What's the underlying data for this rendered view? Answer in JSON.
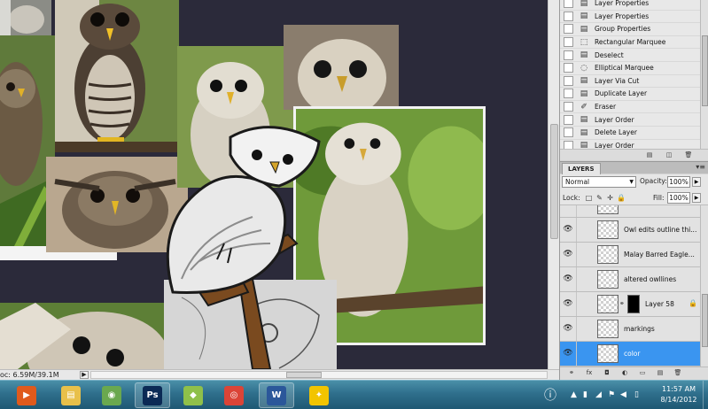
{
  "history": {
    "items": [
      {
        "label": "Layer Properties",
        "icon": "doc-icon"
      },
      {
        "label": "Layer Properties",
        "icon": "doc-icon"
      },
      {
        "label": "Group Properties",
        "icon": "doc-icon"
      },
      {
        "label": "Rectangular Marquee",
        "icon": "rect-marquee-icon"
      },
      {
        "label": "Deselect",
        "icon": "doc-icon"
      },
      {
        "label": "Elliptical Marquee",
        "icon": "ellipse-marquee-icon"
      },
      {
        "label": "Layer Via Cut",
        "icon": "doc-icon"
      },
      {
        "label": "Duplicate Layer",
        "icon": "doc-icon"
      },
      {
        "label": "Eraser",
        "icon": "eraser-icon"
      },
      {
        "label": "Layer Order",
        "icon": "doc-icon"
      },
      {
        "label": "Delete Layer",
        "icon": "doc-icon"
      },
      {
        "label": "Layer Order",
        "icon": "doc-icon"
      }
    ]
  },
  "layers_panel": {
    "tab_label": "LAYERS",
    "blend_mode": "Normal",
    "opacity_label": "Opacity:",
    "opacity_value": "100%",
    "lock_label": "Lock:",
    "fill_label": "Fill:",
    "fill_value": "100%",
    "layers": [
      {
        "name": "",
        "visible": false,
        "selected": false
      },
      {
        "name": "Owl edits outline thi...",
        "visible": true,
        "selected": false
      },
      {
        "name": "Malay Barred Eagle...",
        "visible": true,
        "selected": false
      },
      {
        "name": "altered owllines",
        "visible": true,
        "selected": false
      },
      {
        "name": "Layer 58",
        "visible": true,
        "selected": false,
        "has_mask": true
      },
      {
        "name": "markings",
        "visible": true,
        "selected": false
      },
      {
        "name": "color",
        "visible": true,
        "selected": true
      }
    ]
  },
  "status": {
    "doc": "oc: 6.59M/39.1M"
  },
  "taskbar": {
    "apps": [
      {
        "name": "media-player",
        "color": "#e05a1c",
        "glyph": "▶"
      },
      {
        "name": "file-explorer",
        "color": "#e8c04a",
        "glyph": "▤"
      },
      {
        "name": "app-3",
        "color": "#6aa84f",
        "glyph": "◉"
      },
      {
        "name": "photoshop",
        "color": "#0b2a55",
        "glyph": "Ps"
      },
      {
        "name": "app-5",
        "color": "#8fc04a",
        "glyph": "◆"
      },
      {
        "name": "chrome",
        "color": "#db4437",
        "glyph": "◎"
      },
      {
        "name": "word",
        "color": "#2b579a",
        "glyph": "W"
      },
      {
        "name": "aim",
        "color": "#f2c400",
        "glyph": "✦"
      }
    ],
    "clock_time": "11:57 AM",
    "clock_date": "8/14/2012"
  }
}
